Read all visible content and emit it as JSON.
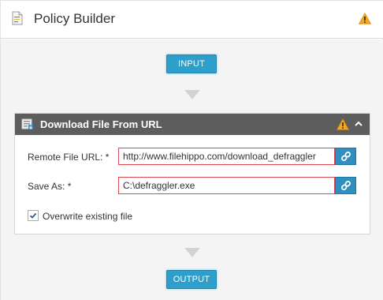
{
  "header": {
    "title": "Policy Builder",
    "doc_icon": "document-icon",
    "warning_icon": "warning-icon",
    "warning_color": "#f5a623"
  },
  "flow": {
    "input_label": "INPUT",
    "output_label": "OUTPUT",
    "button_color": "#2e9ecb"
  },
  "step": {
    "title": "Download File From URL",
    "icon": "download-file-icon",
    "header_color": "#5d5d5d",
    "fields": {
      "remote_url_label": "Remote File URL: *",
      "remote_url_value": "http://www.filehippo.com/download_defraggler",
      "save_as_label": "Save As: *",
      "save_as_value": "C:\\defraggler.exe"
    },
    "overwrite": {
      "label": "Overwrite existing file",
      "checked": true
    },
    "error_border_color": "#e0484f"
  }
}
